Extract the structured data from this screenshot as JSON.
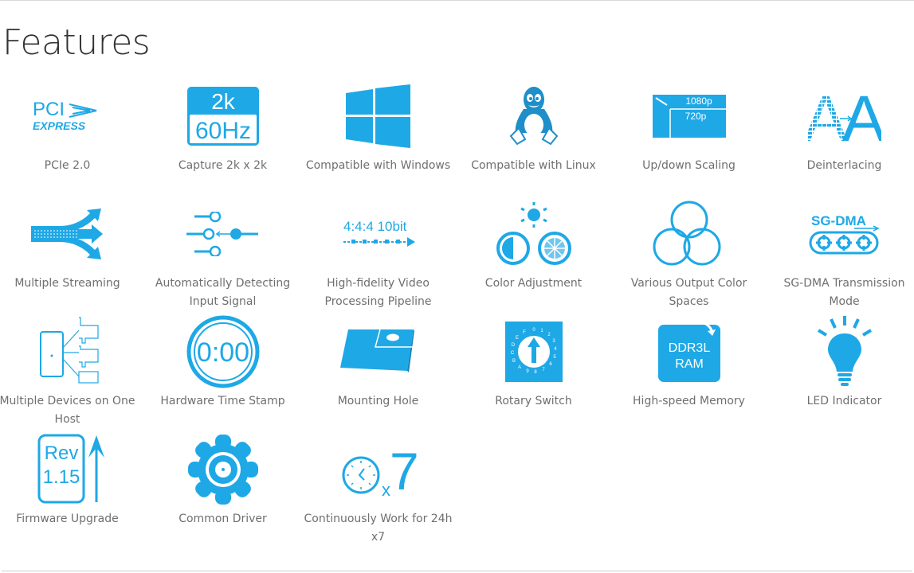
{
  "page": {
    "title": "Features"
  },
  "colors": {
    "accent": "#1ea8e6",
    "label_text": "#6f6f6f",
    "heading_text": "#333333"
  },
  "features": [
    {
      "label": "PCIe 2.0",
      "icon": "pci-express-logo",
      "icon_text": [
        "PCI",
        "EXPRESS"
      ]
    },
    {
      "label": "Capture 2k x 2k",
      "icon": "resolution-badge",
      "icon_text": [
        "2k",
        "60Hz"
      ]
    },
    {
      "label": "Compatible with Windows",
      "icon": "windows-logo"
    },
    {
      "label": "Compatible with Linux",
      "icon": "linux-penguin"
    },
    {
      "label": "Up/down Scaling",
      "icon": "scaling",
      "icon_text": [
        "1080p",
        "720p"
      ]
    },
    {
      "label": "Deinterlacing",
      "icon": "deinterlace",
      "icon_text": [
        "A",
        "A"
      ]
    },
    {
      "label": "Multiple Streaming",
      "icon": "multi-stream-arrows"
    },
    {
      "label": "Automatically Detecting Input Signal",
      "icon": "signal-detect"
    },
    {
      "label": "High-fidelity Video Processing Pipeline",
      "icon": "pipeline",
      "icon_text": [
        "4:4:4 10bit"
      ]
    },
    {
      "label": "Color Adjustment",
      "icon": "color-adjust"
    },
    {
      "label": "Various Output Color Spaces",
      "icon": "color-spaces-circles"
    },
    {
      "label": "SG-DMA Transmission Mode",
      "icon": "sg-dma",
      "icon_text": [
        "SG-DMA"
      ]
    },
    {
      "label": "Multiple Devices on One Host",
      "icon": "multi-device"
    },
    {
      "label": "Hardware Time Stamp",
      "icon": "timestamp",
      "icon_text": [
        "0:00"
      ]
    },
    {
      "label": "Mounting Hole",
      "icon": "mounting-hole"
    },
    {
      "label": "Rotary Switch",
      "icon": "rotary-switch",
      "icon_text": [
        "0",
        "1",
        "2",
        "3",
        "4",
        "5",
        "6",
        "7",
        "8",
        "9",
        "A",
        "B",
        "C",
        "D",
        "E",
        "F"
      ]
    },
    {
      "label": "High-speed Memory",
      "icon": "memory",
      "icon_text": [
        "DDR3L",
        "RAM"
      ]
    },
    {
      "label": "LED Indicator",
      "icon": "led-bulb"
    },
    {
      "label": "Firmware Upgrade",
      "icon": "firmware",
      "icon_text": [
        "Rev",
        "1.15"
      ]
    },
    {
      "label": "Common Driver",
      "icon": "gear"
    },
    {
      "label": "Continuously Work for 24h x7",
      "icon": "clock-24x7",
      "icon_text": [
        "x",
        "7"
      ]
    }
  ]
}
